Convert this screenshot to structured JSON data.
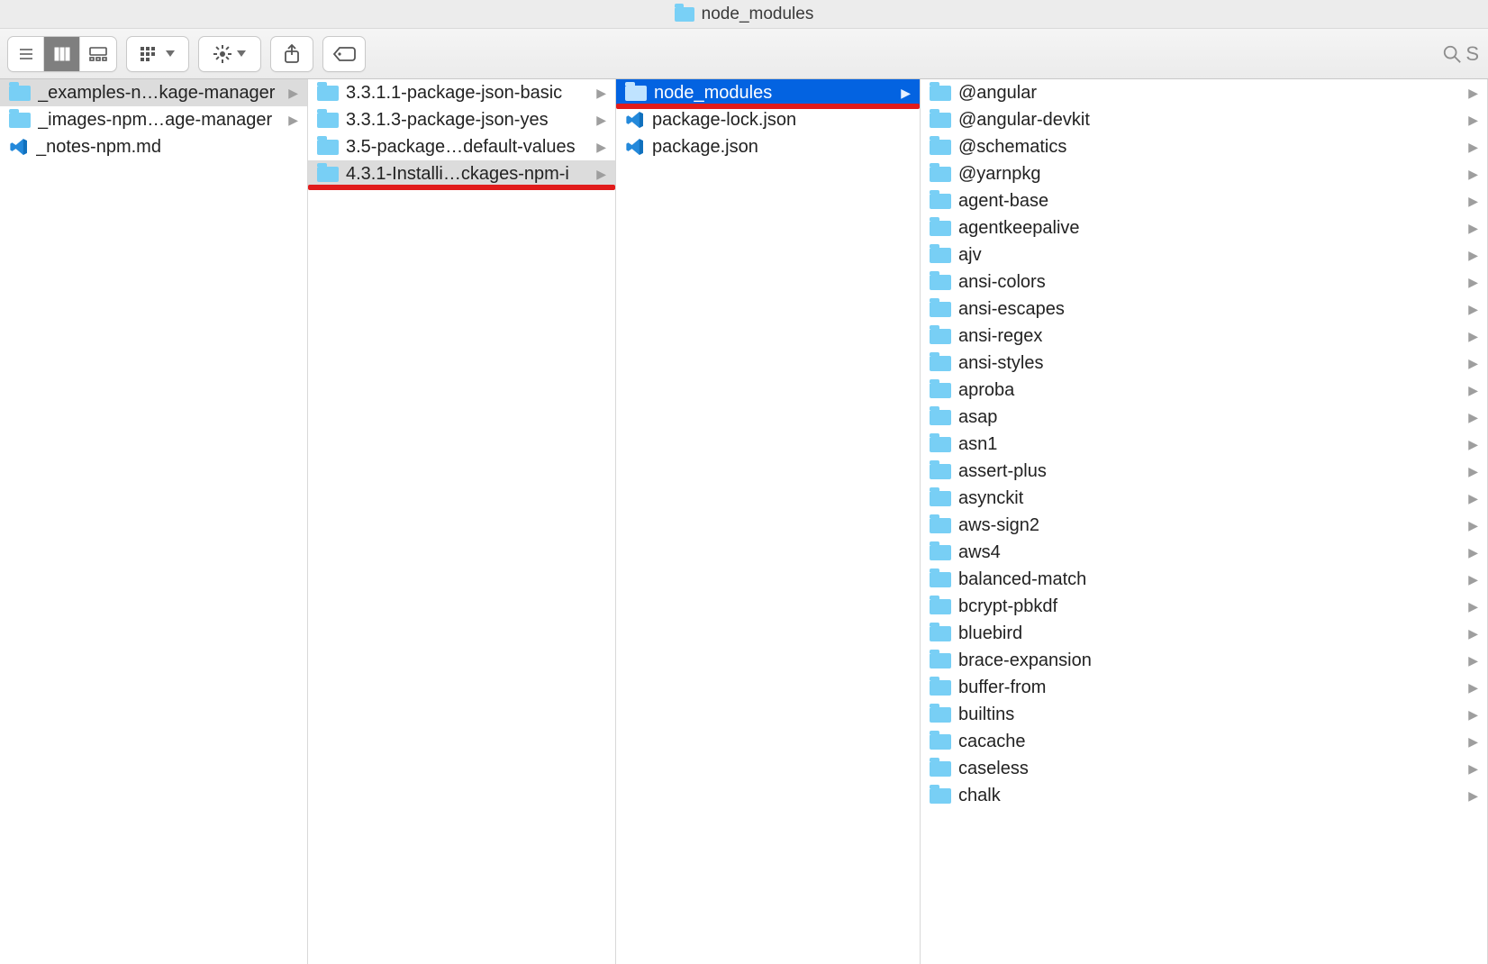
{
  "title": "node_modules",
  "search_placeholder": "S",
  "columns": [
    {
      "items": [
        {
          "kind": "folder",
          "label": "_examples-n…kage-manager",
          "disclosure": true,
          "selected": "grey"
        },
        {
          "kind": "folder",
          "label": "_images-npm…age-manager",
          "disclosure": true
        },
        {
          "kind": "vscode",
          "label": "_notes-npm.md"
        }
      ]
    },
    {
      "items": [
        {
          "kind": "folder",
          "label": "3.3.1.1-package-json-basic",
          "disclosure": true
        },
        {
          "kind": "folder",
          "label": "3.3.1.3-package-json-yes",
          "disclosure": true
        },
        {
          "kind": "folder",
          "label": "3.5-package…default-values",
          "disclosure": true
        },
        {
          "kind": "folder",
          "label": "4.3.1-Installi…ckages-npm-i",
          "disclosure": true,
          "selected": "grey",
          "underline": true
        }
      ]
    },
    {
      "items": [
        {
          "kind": "folder",
          "label": "node_modules",
          "disclosure": true,
          "selected": "blue",
          "underline": true
        },
        {
          "kind": "vscode",
          "label": "package-lock.json"
        },
        {
          "kind": "vscode",
          "label": "package.json"
        }
      ]
    },
    {
      "items": [
        {
          "kind": "folder",
          "label": "@angular",
          "disclosure": true
        },
        {
          "kind": "folder",
          "label": "@angular-devkit",
          "disclosure": true
        },
        {
          "kind": "folder",
          "label": "@schematics",
          "disclosure": true
        },
        {
          "kind": "folder",
          "label": "@yarnpkg",
          "disclosure": true
        },
        {
          "kind": "folder",
          "label": "agent-base",
          "disclosure": true
        },
        {
          "kind": "folder",
          "label": "agentkeepalive",
          "disclosure": true
        },
        {
          "kind": "folder",
          "label": "ajv",
          "disclosure": true
        },
        {
          "kind": "folder",
          "label": "ansi-colors",
          "disclosure": true
        },
        {
          "kind": "folder",
          "label": "ansi-escapes",
          "disclosure": true
        },
        {
          "kind": "folder",
          "label": "ansi-regex",
          "disclosure": true
        },
        {
          "kind": "folder",
          "label": "ansi-styles",
          "disclosure": true
        },
        {
          "kind": "folder",
          "label": "aproba",
          "disclosure": true
        },
        {
          "kind": "folder",
          "label": "asap",
          "disclosure": true
        },
        {
          "kind": "folder",
          "label": "asn1",
          "disclosure": true
        },
        {
          "kind": "folder",
          "label": "assert-plus",
          "disclosure": true
        },
        {
          "kind": "folder",
          "label": "asynckit",
          "disclosure": true
        },
        {
          "kind": "folder",
          "label": "aws-sign2",
          "disclosure": true
        },
        {
          "kind": "folder",
          "label": "aws4",
          "disclosure": true
        },
        {
          "kind": "folder",
          "label": "balanced-match",
          "disclosure": true
        },
        {
          "kind": "folder",
          "label": "bcrypt-pbkdf",
          "disclosure": true
        },
        {
          "kind": "folder",
          "label": "bluebird",
          "disclosure": true
        },
        {
          "kind": "folder",
          "label": "brace-expansion",
          "disclosure": true
        },
        {
          "kind": "folder",
          "label": "buffer-from",
          "disclosure": true
        },
        {
          "kind": "folder",
          "label": "builtins",
          "disclosure": true
        },
        {
          "kind": "folder",
          "label": "cacache",
          "disclosure": true
        },
        {
          "kind": "folder",
          "label": "caseless",
          "disclosure": true
        },
        {
          "kind": "folder",
          "label": "chalk",
          "disclosure": true
        }
      ]
    }
  ]
}
